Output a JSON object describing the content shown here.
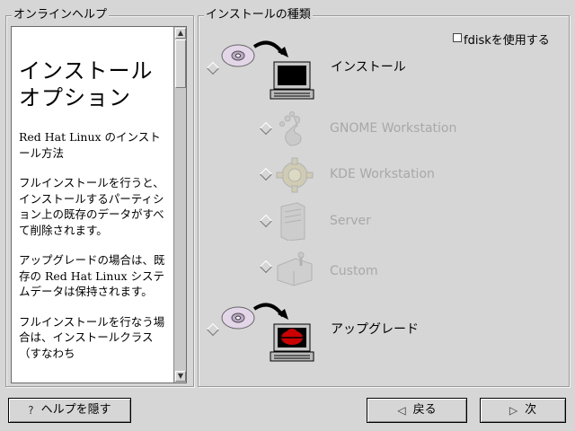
{
  "help_panel": {
    "frame_title": "オンラインヘルプ",
    "heading": "インストールオプション",
    "paragraphs": [
      "Red Hat Linux のインストール方法",
      "フルインストールを行うと、インストールするパーティション上の既存のデータがすべて削除されます。",
      "アップグレードの場合は、既存の Red Hat Linux システムデータは保持されます。",
      "フルインストールを行なう場合は、インストールクラス（すなわち"
    ]
  },
  "install_type": {
    "frame_title": "インストールの種類",
    "fdisk_label": "fdiskを使用する",
    "fdisk_checked": false,
    "options": [
      {
        "label": "インストール",
        "enabled": true,
        "selected": true,
        "icon": "install-cd-computer-icon"
      },
      {
        "label": "GNOME Workstation",
        "enabled": false,
        "icon": "gnome-foot-icon"
      },
      {
        "label": "KDE Workstation",
        "enabled": false,
        "icon": "kde-gear-icon"
      },
      {
        "label": "Server",
        "enabled": false,
        "icon": "server-tower-icon"
      },
      {
        "label": "Custom",
        "enabled": false,
        "icon": "custom-toolbox-icon"
      },
      {
        "label": "アップグレード",
        "enabled": true,
        "selected": false,
        "icon": "upgrade-cd-redhat-icon"
      }
    ]
  },
  "buttons": {
    "help": {
      "label": "ヘルプを隠す",
      "icon": "question-icon"
    },
    "back": {
      "label": "戻る",
      "icon": "left-triangle-icon"
    },
    "next": {
      "label": "次",
      "icon": "right-triangle-icon"
    }
  },
  "colors": {
    "background": "#d6d6d6",
    "disabled_text": "#a8a8a8",
    "redhat_red": "#cc0000"
  }
}
